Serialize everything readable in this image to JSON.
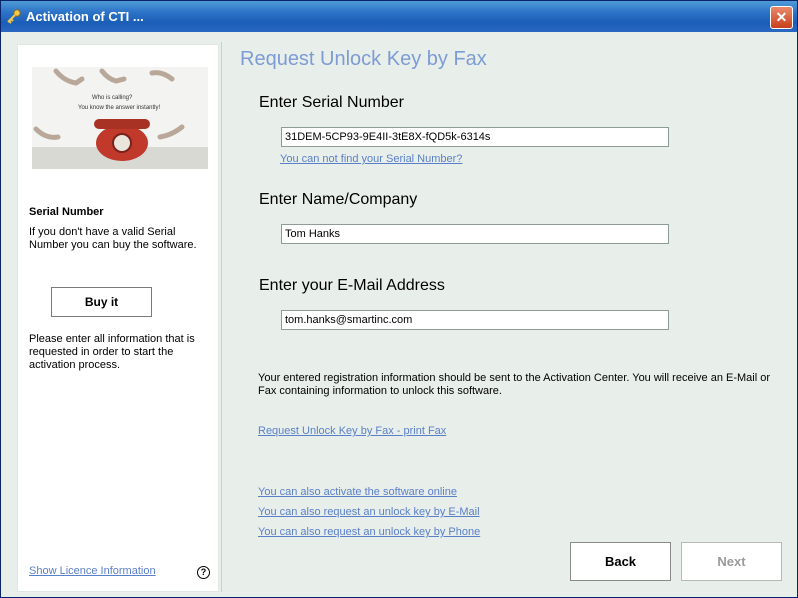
{
  "window": {
    "title": "Activation of CTI ...",
    "close_icon": "close-icon"
  },
  "sidebar": {
    "photo_caption_line1": "Who is calling?",
    "photo_caption_line2": "You know the answer instantly!",
    "serial_heading": "Serial Number",
    "serial_description": "If you don't have a valid Serial Number you can buy the software.",
    "buy_label": "Buy it",
    "info_description": "Please enter all information that is requested in order to start the activation process.",
    "licence_link": "Show Licence Information",
    "help_icon": "?"
  },
  "main": {
    "title": "Request Unlock Key by Fax",
    "serial": {
      "label": "Enter Serial Number",
      "value": "31DEM-5CP93-9E4II-3tE8X-fQD5k-6314s",
      "help_link": "You can not find your Serial Number?"
    },
    "name": {
      "label": "Enter Name/Company",
      "value": "Tom Hanks"
    },
    "email": {
      "label": "Enter your E-Mail Address",
      "value": "tom.hanks@smartinc.com"
    },
    "info_text": "Your entered registration information should be sent to the Activation Center. You will receive an E-Mail or Fax containing information to unlock this software.",
    "print_fax_link": "Request Unlock Key by Fax - print Fax",
    "alt_links": [
      "You can also activate the software online",
      "You can also request an unlock key by E-Mail",
      "You can also request an unlock key by Phone"
    ]
  },
  "buttons": {
    "back": "Back",
    "next": "Next"
  },
  "colors": {
    "title_bar": "#2d74c8",
    "link": "#5a7fc8",
    "heading": "#7d9bd4",
    "background": "#e8efeb"
  }
}
